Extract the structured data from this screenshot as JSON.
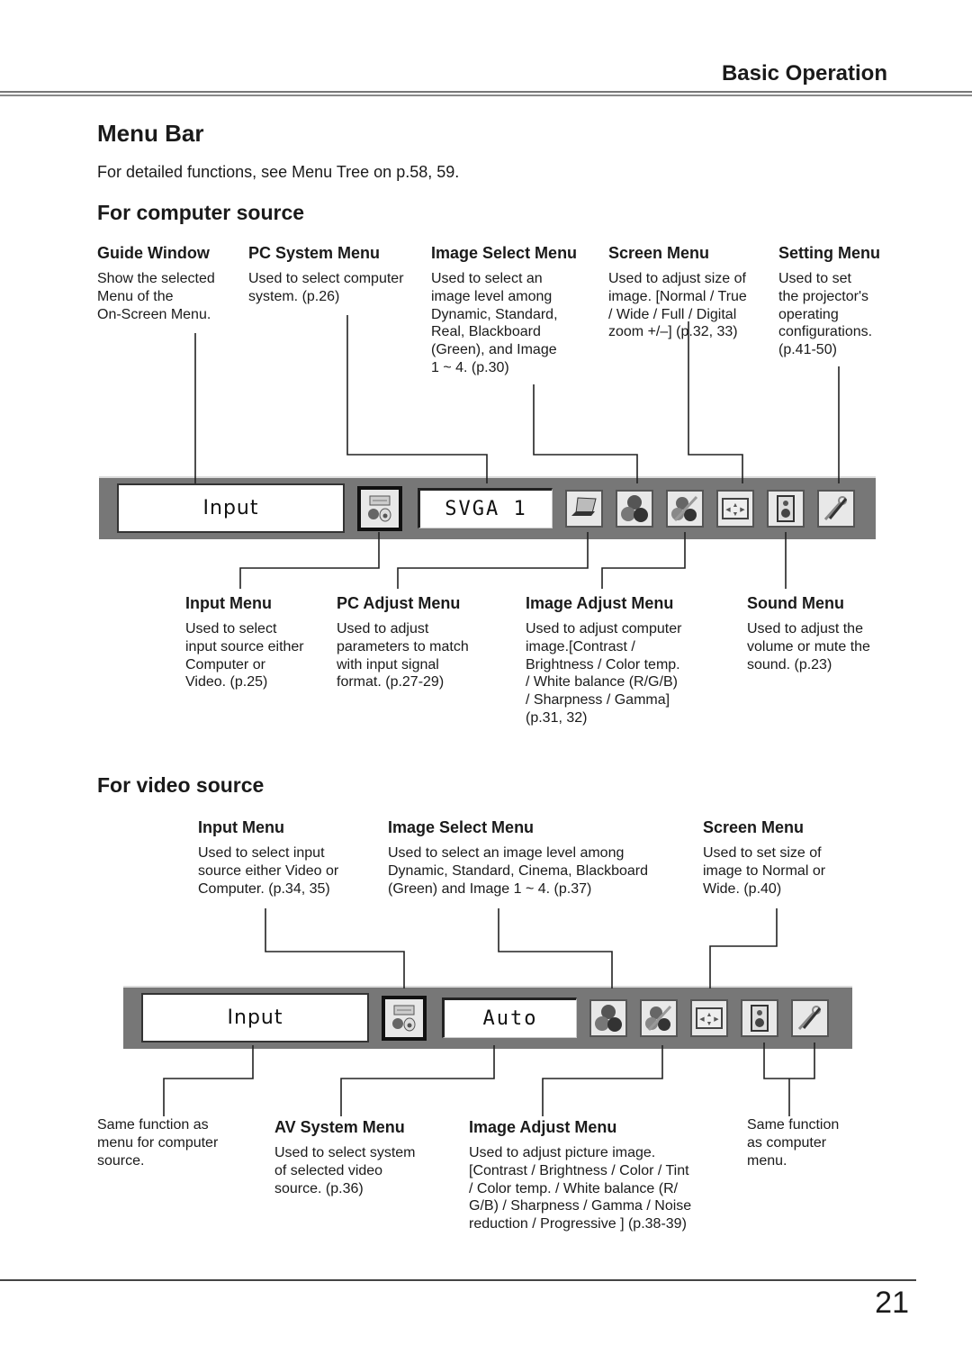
{
  "header": {
    "section_title": "Basic Operation"
  },
  "page": {
    "title": "Menu Bar",
    "intro": "For detailed functions, see Menu Tree on p.58, 59.",
    "page_number": "21"
  },
  "computer_source": {
    "heading": "For computer source",
    "top_callouts": [
      {
        "title": "Guide Window",
        "text": "Show the selected\nMenu of the\nOn-Screen Menu."
      },
      {
        "title": "PC System Menu",
        "text": "Used to select computer\nsystem. (p.26)"
      },
      {
        "title": "Image Select Menu",
        "text": "Used to select an\nimage level among\nDynamic, Standard,\nReal, Blackboard\n(Green), and Image\n1 ~ 4. (p.30)"
      },
      {
        "title": "Screen Menu",
        "text": "Used to adjust size of\nimage. [Normal / True\n/ Wide / Full / Digital\nzoom +/–] (p.32, 33)"
      },
      {
        "title": "Setting Menu",
        "text": "Used to set\nthe projector's\noperating\nconfigurations.\n(p.41-50)"
      }
    ],
    "menu_bar": {
      "guide_window_text": "Input",
      "system_field_text": "SVGA 1",
      "icons": [
        "input-menu-icon",
        "pc-adjust-icon",
        "image-select-icon",
        "image-adjust-icon",
        "screen-icon",
        "sound-icon",
        "setting-icon"
      ]
    },
    "bottom_callouts": [
      {
        "title": "Input Menu",
        "text": "Used to select\ninput source either\nComputer or\nVideo. (p.25)"
      },
      {
        "title": "PC Adjust Menu",
        "text": "Used to adjust\nparameters to match\nwith input signal\nformat. (p.27-29)"
      },
      {
        "title": "Image Adjust Menu",
        "text": "Used to adjust computer\nimage.[Contrast /\nBrightness / Color temp.\n/ White balance (R/G/B)\n/ Sharpness / Gamma]\n(p.31, 32)"
      },
      {
        "title": "Sound Menu",
        "text": "Used to adjust the\nvolume or mute the\nsound. (p.23)"
      }
    ]
  },
  "video_source": {
    "heading": "For video source",
    "top_callouts": [
      {
        "title": "Input Menu",
        "text": "Used to select input\nsource either Video or\nComputer. (p.34, 35)"
      },
      {
        "title": "Image Select Menu",
        "text": "Used to select an image level among\nDynamic, Standard, Cinema, Blackboard\n(Green) and Image 1 ~ 4. (p.37)"
      },
      {
        "title": "Screen Menu",
        "text": "Used to set size of\nimage to Normal or\nWide. (p.40)"
      }
    ],
    "menu_bar": {
      "guide_window_text": "Input",
      "system_field_text": "Auto",
      "icons": [
        "input-menu-icon",
        "image-select-icon",
        "image-adjust-icon",
        "screen-icon",
        "sound-icon",
        "setting-icon"
      ]
    },
    "bottom_callouts": [
      {
        "title": "",
        "text": "Same function as\nmenu for computer\nsource."
      },
      {
        "title": "AV System Menu",
        "text": "Used to select system\nof selected video\nsource. (p.36)"
      },
      {
        "title": "Image Adjust Menu",
        "text": "Used to adjust picture image.\n[Contrast / Brightness / Color / Tint\n/ Color temp. / White balance (R/\nG/B) / Sharpness / Gamma / Noise\nreduction / Progressive ] (p.38-39)"
      },
      {
        "title": "",
        "text": "Same function\nas computer\nmenu."
      }
    ]
  }
}
